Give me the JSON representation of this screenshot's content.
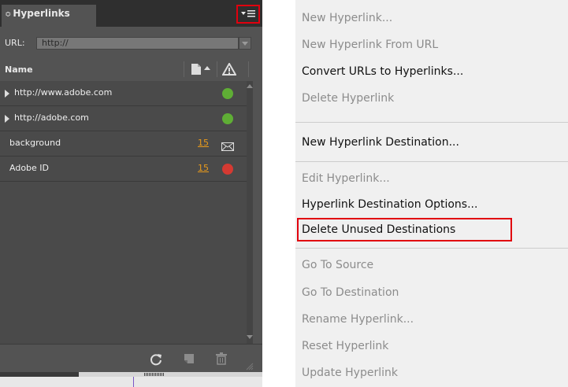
{
  "panel": {
    "title": "Hyperlinks",
    "title_prefix": "≎",
    "url_label": "URL:",
    "url_value": "http://",
    "column_name": "Name",
    "rows": [
      {
        "label": "http://www.adobe.com",
        "status": "green"
      },
      {
        "label": "http://adobe.com",
        "status": "green"
      },
      {
        "label": "background",
        "page": "15",
        "status": "envelope"
      },
      {
        "label": "Adobe ID",
        "page": "15",
        "status": "red"
      }
    ]
  },
  "menu": {
    "items": [
      {
        "label": "New Hyperlink...",
        "enabled": false
      },
      {
        "label": "New Hyperlink From URL",
        "enabled": false
      },
      {
        "label": "Convert URLs to Hyperlinks...",
        "enabled": true
      },
      {
        "label": "Delete Hyperlink",
        "enabled": false
      },
      {
        "label": "New Hyperlink Destination...",
        "enabled": true
      },
      {
        "label": "Edit Hyperlink...",
        "enabled": false
      },
      {
        "label": "Hyperlink Destination Options...",
        "enabled": true
      },
      {
        "label": "Delete Unused Destinations",
        "enabled": true,
        "highlighted": true
      },
      {
        "label": "Go To Source",
        "enabled": false
      },
      {
        "label": "Go To Destination",
        "enabled": false
      },
      {
        "label": "Rename Hyperlink...",
        "enabled": false
      },
      {
        "label": "Reset Hyperlink",
        "enabled": false
      },
      {
        "label": "Update Hyperlink",
        "enabled": false
      }
    ]
  },
  "colors": {
    "panel_bg": "#535353",
    "status_green": "#5fae35",
    "status_red": "#d53a32",
    "page_number": "#e89a1b",
    "highlight_border": "#e1000e"
  }
}
